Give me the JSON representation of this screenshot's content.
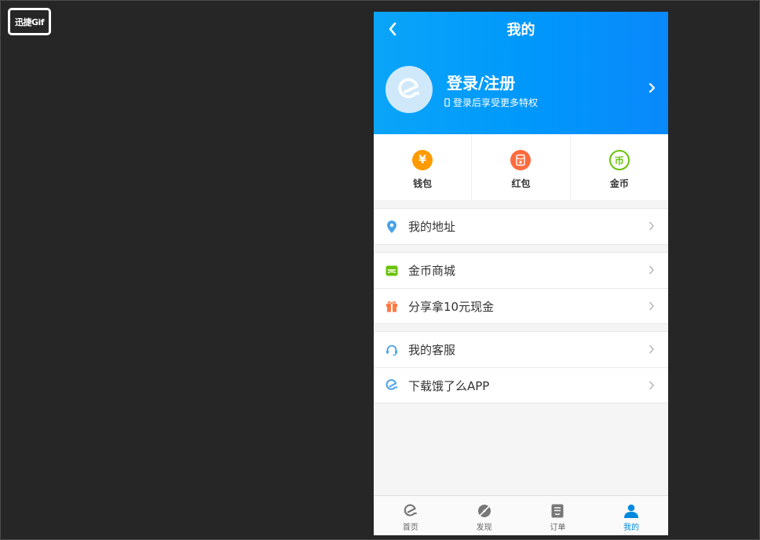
{
  "watermark": "迅捷Gif",
  "header": {
    "title": "我的",
    "login_title": "登录/注册",
    "login_subtitle": "登录后享受更多特权"
  },
  "stats": [
    {
      "label": "钱包",
      "icon": "yen-icon",
      "color": "#ff9a00"
    },
    {
      "label": "红包",
      "icon": "red-packet-icon",
      "color": "#ff6a3d"
    },
    {
      "label": "金币",
      "icon": "coin-icon",
      "color": "#6ac20b"
    }
  ],
  "menu_groups": [
    [
      {
        "label": "我的地址",
        "icon": "location-pin-icon"
      }
    ],
    [
      {
        "label": "金币商城",
        "icon": "coin-mall-icon"
      },
      {
        "label": "分享拿10元现金",
        "icon": "gift-icon"
      }
    ],
    [
      {
        "label": "我的客服",
        "icon": "headset-icon"
      },
      {
        "label": "下载饿了么APP",
        "icon": "eleme-logo-icon"
      }
    ]
  ],
  "tabs": [
    {
      "label": "首页",
      "icon": "home-icon"
    },
    {
      "label": "发现",
      "icon": "discover-icon"
    },
    {
      "label": "订单",
      "icon": "order-icon"
    },
    {
      "label": "我的",
      "icon": "profile-icon",
      "active": true
    }
  ],
  "colors": {
    "header_blue": "#0097fb",
    "active_tab": "#0089dc",
    "background": "#f5f5f5"
  }
}
